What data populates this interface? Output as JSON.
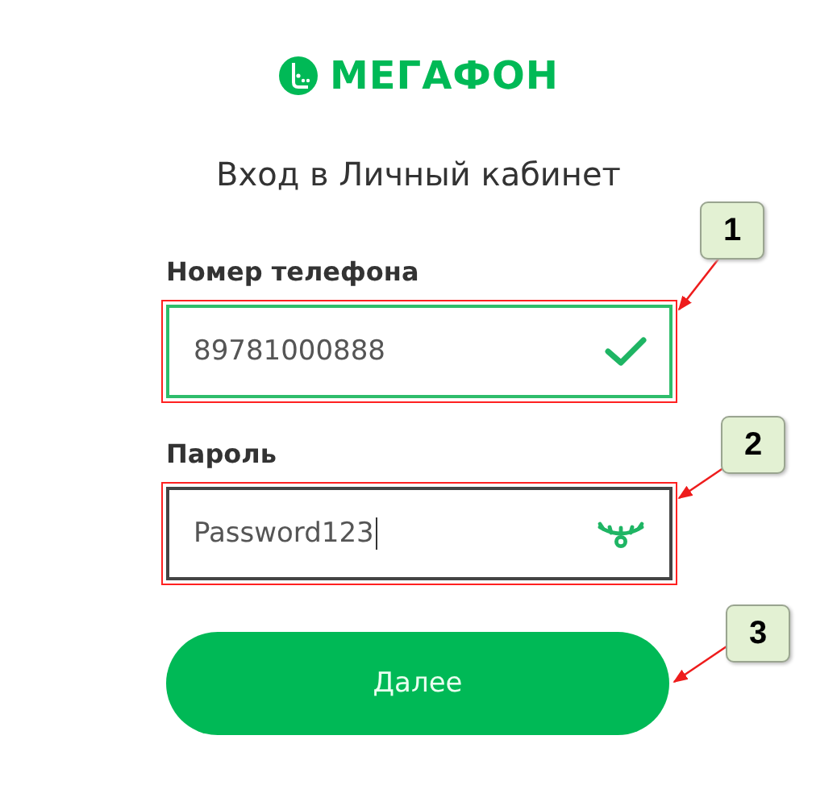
{
  "logo": {
    "text": "МЕГАФОН"
  },
  "title": "Вход в Личный кабинет",
  "fields": [
    {
      "label": "Номер телефона",
      "value": "89781000888",
      "kind": "phone",
      "valid": true,
      "focused": false,
      "highlighted": true
    },
    {
      "label": "Пароль",
      "value": "Password123",
      "kind": "password",
      "valid": false,
      "focused": true,
      "highlighted": true
    }
  ],
  "button": {
    "label": "Далее"
  },
  "callouts": [
    {
      "number": "1"
    },
    {
      "number": "2"
    },
    {
      "number": "3"
    }
  ]
}
